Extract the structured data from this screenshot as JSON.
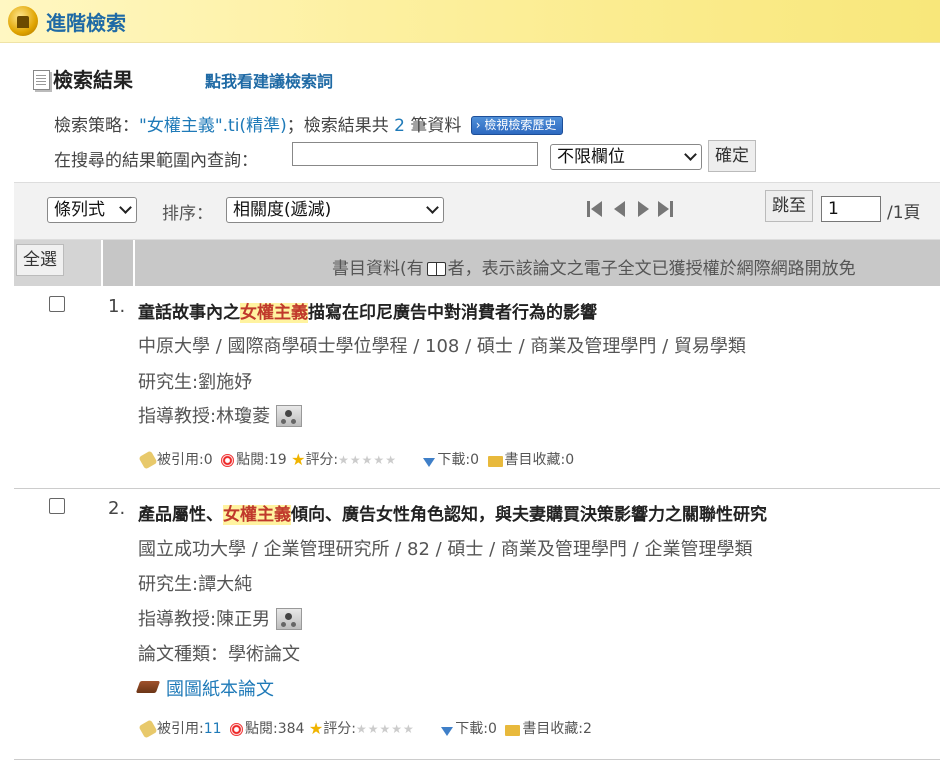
{
  "header": {
    "title": "進階檢索"
  },
  "results": {
    "heading": "檢索結果",
    "suggest_link": "點我看建議檢索詞",
    "strategy_label": "檢索策略：",
    "strategy_query": "\"女權主義\".ti(精準)",
    "strategy_sep": "；檢索結果共",
    "count": "2",
    "count_suffix": "筆資料",
    "history_button": "檢視檢索歷史",
    "within_label": "在搜尋的結果範圍內查詢：",
    "within_value": "",
    "field_select": "不限欄位",
    "confirm_button": "確定"
  },
  "toolbar": {
    "view_select": "條列式",
    "sort_label": "排序：",
    "sort_select": "相關度(遞減)",
    "jump_button": "跳至",
    "page_value": "1",
    "page_total": "/1頁"
  },
  "table_header": {
    "select_all": "全選",
    "col_text_before": "書目資料(有",
    "col_text_after": "者，表示該論文之電子全文已獲授權於網際網路開放免"
  },
  "records": [
    {
      "num": "1.",
      "title_before": "童話故事內之",
      "title_highlight": "女權主義",
      "title_after": "描寫在印尼廣告中對消費者行為的影響",
      "meta": "中原大學 / 國際商學碩士學位學程 / 108 / 碩士 / 商業及管理學門 / 貿易學類",
      "student": "研究生:劉施妤",
      "advisor": "指導教授:林瓊菱",
      "cite_label": "被引用:",
      "cite": "0",
      "view_label": "點閱:",
      "view": "19",
      "rating_label": "評分:",
      "download_label": "下載:",
      "download": "0",
      "fav_label": "書目收藏:",
      "fav": "0"
    },
    {
      "num": "2.",
      "title_before": "產品屬性、",
      "title_highlight": "女權主義",
      "title_after": "傾向、廣告女性角色認知，與夫妻購買決策影響力之關聯性研究",
      "meta": "國立成功大學 / 企業管理研究所 / 82 / 碩士 / 商業及管理學門 / 企業管理學類",
      "student": "研究生:譚大純",
      "advisor": "指導教授:陳正男",
      "type": "論文種類：學術論文",
      "paper_link": "國圖紙本論文",
      "cite_label": "被引用:",
      "cite": "11",
      "view_label": "點閱:",
      "view": "384",
      "rating_label": "評分:",
      "download_label": "下載:",
      "download": "0",
      "fav_label": "書目收藏:",
      "fav": "2"
    }
  ],
  "stars": "★★★★★",
  "colors": {
    "accent": "#1f6aa5",
    "highlight_bg": "#fff3a0",
    "highlight_fg": "#c0392b"
  }
}
